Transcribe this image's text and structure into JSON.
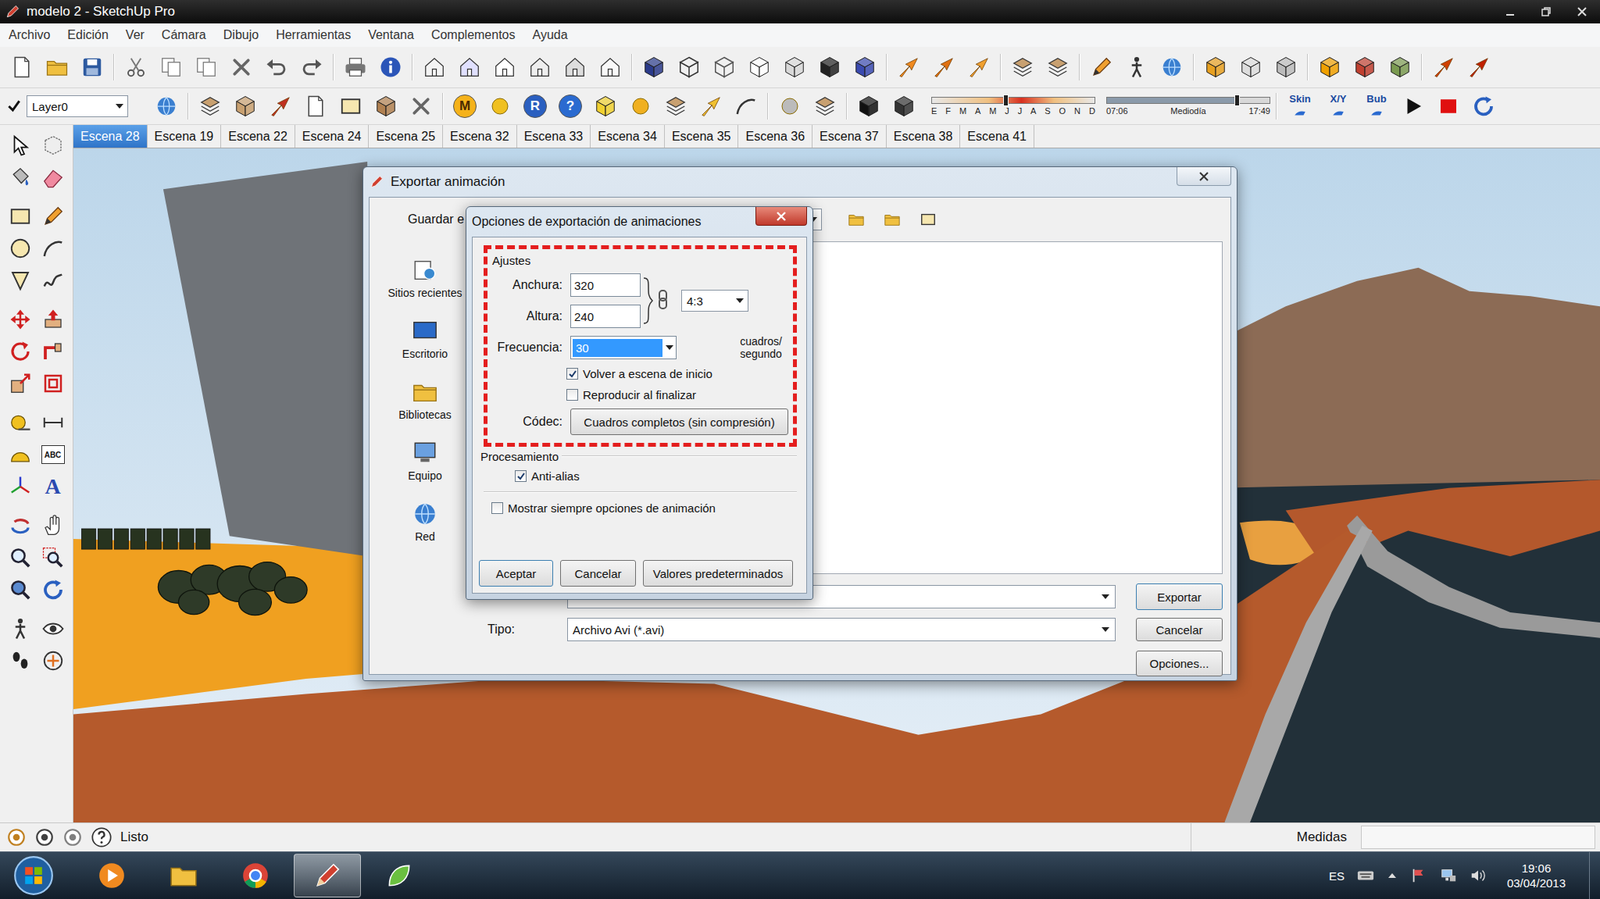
{
  "window": {
    "title": "modelo 2 - SketchUp Pro"
  },
  "menu": [
    "Archivo",
    "Edición",
    "Ver",
    "Cámara",
    "Dibujo",
    "Herramientas",
    "Ventana",
    "Complementos",
    "Ayuda"
  ],
  "toolbar": {
    "layer": {
      "name": "Layer0",
      "visible": true
    },
    "glyphs": [
      "M",
      "R",
      "?"
    ],
    "shadow": {
      "months": [
        "E",
        "F",
        "M",
        "A",
        "M",
        "J",
        "J",
        "A",
        "S",
        "O",
        "N",
        "D"
      ],
      "date_level": 0.45,
      "times": [
        "07:06",
        "Mediodía",
        "17:49"
      ],
      "time_level": 0.8
    },
    "plugins": [
      "Skin",
      "X/Y",
      "Bub"
    ]
  },
  "left_toolbar": {
    "glyphs": [
      "ABC",
      "A"
    ]
  },
  "scenes": [
    {
      "label": "Escena 28",
      "selected": true
    },
    {
      "label": "Escena 19",
      "selected": false
    },
    {
      "label": "Escena 22",
      "selected": false
    },
    {
      "label": "Escena 24",
      "selected": false
    },
    {
      "label": "Escena 25",
      "selected": false
    },
    {
      "label": "Escena 32",
      "selected": false
    },
    {
      "label": "Escena 33",
      "selected": false
    },
    {
      "label": "Escena 34",
      "selected": false
    },
    {
      "label": "Escena 35",
      "selected": false
    },
    {
      "label": "Escena 36",
      "selected": false
    },
    {
      "label": "Escena 37",
      "selected": false
    },
    {
      "label": "Escena 38",
      "selected": false
    },
    {
      "label": "Escena 41",
      "selected": false
    }
  ],
  "export_dialog": {
    "title": "Exportar animación",
    "save_in": "Guardar e",
    "places": [
      "Sitios recientes",
      "Escritorio",
      "Bibliotecas",
      "Equipo",
      "Red"
    ],
    "file_name": "",
    "type_label": "Tipo:",
    "type_value": "Archivo Avi (*.avi)",
    "buttons": [
      "Exportar",
      "Cancelar",
      "Opciones..."
    ]
  },
  "options_dialog": {
    "title": "Opciones de exportación de animaciones",
    "highlighted": true,
    "settings_group": "Ajustes",
    "width": {
      "label": "Anchura:",
      "value": "320"
    },
    "height": {
      "label": "Altura:",
      "value": "240"
    },
    "linked": true,
    "aspect": "4:3",
    "frequency": {
      "label": "Frecuencia:",
      "value": "30",
      "unit": "cuadros/ segundo"
    },
    "checks": [
      {
        "label": "Volver a escena de inicio",
        "checked": true
      },
      {
        "label": "Reproducir al finalizar",
        "checked": false
      }
    ],
    "codec": {
      "label": "Códec:",
      "value": "Cuadros completos (sin compresión)"
    },
    "processing_group": "Procesamiento",
    "antialias": {
      "label": "Anti-alias",
      "checked": true
    },
    "always_show": {
      "label": "Mostrar siempre opciones de animación",
      "checked": false
    },
    "buttons": [
      "Aceptar",
      "Cancelar",
      "Valores predeterminados"
    ]
  },
  "status_bar": {
    "message": "Listo",
    "measurements_label": "Medidas"
  },
  "taskbar": {
    "language": "ES",
    "time": "19:06",
    "date": "03/04/2013",
    "apps": [
      {
        "kind": "media",
        "active": false
      },
      {
        "kind": "explorer",
        "active": false
      },
      {
        "kind": "chrome",
        "active": false
      },
      {
        "kind": "sketchup",
        "active": true
      },
      {
        "kind": "other",
        "active": false
      }
    ]
  }
}
